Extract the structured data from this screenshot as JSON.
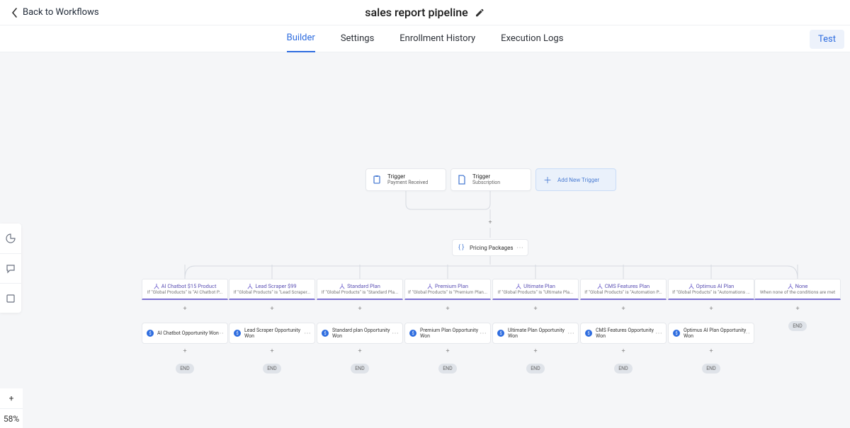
{
  "header": {
    "back_label": "Back to Workflows",
    "title": "sales report pipeline",
    "test_button": "Test"
  },
  "tabs": {
    "builder": "Builder",
    "settings": "Settings",
    "enrollment": "Enrollment History",
    "execution": "Execution Logs"
  },
  "side_tools": {
    "stats": "stats",
    "comments": "comments",
    "notes": "notes",
    "add": "+",
    "zoom": "58%"
  },
  "triggers": {
    "label": "Trigger",
    "payment": "Payment Received",
    "subscription": "Subscription",
    "add_new": "Add New Trigger"
  },
  "action_pricing": {
    "label": "Pricing Packages"
  },
  "branches": [
    {
      "title": "AI Chatbot $15 Product",
      "desc": "If \"Global Products\" is \"AI Chatbot P..."
    },
    {
      "title": "Lead Scraper $99",
      "desc": "If \"Global Products\" is \"Lead Scraper..."
    },
    {
      "title": "Standard Plan",
      "desc": "If \"Global Products\" is \"Standard Pla..."
    },
    {
      "title": "Premium Plan",
      "desc": "If \"Global Products\" is \"Premium Plan..."
    },
    {
      "title": "Ultimate Plan",
      "desc": "If \"Global Products\" is \"Ultimate Pla..."
    },
    {
      "title": "CMS Features Plan",
      "desc": "If \"Global Products\" is \"Automation P..."
    },
    {
      "title": "Optimus AI Plan",
      "desc": "If \"Global Products\" is \"Automations ..."
    },
    {
      "title": "None",
      "desc": "When none of the conditions are met"
    }
  ],
  "opps": [
    "AI Chatbot Opportunity Won",
    "Lead Scraper Opportunity Won",
    "Standard plan Opportunity Won",
    "Premium Plan Opportunity Won",
    "Ultimate Plan Opportunity Won",
    "CMS Features Opportunity Won",
    "Optimus AI Plan Opportunity Won"
  ],
  "end_label": "END"
}
